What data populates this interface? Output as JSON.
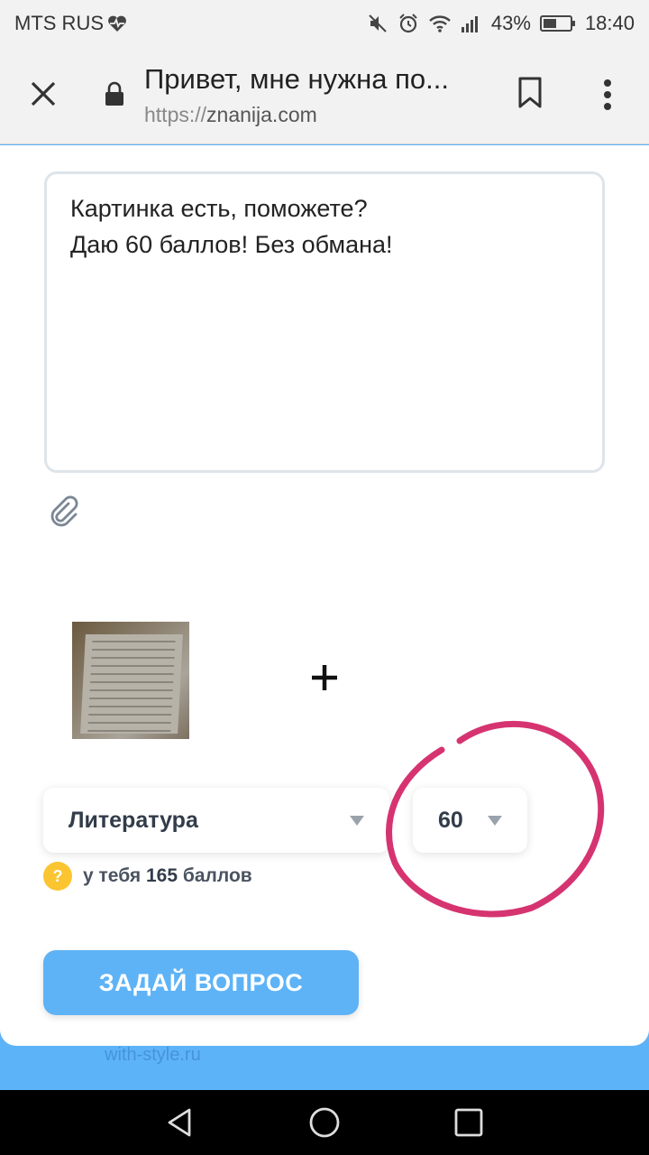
{
  "status_bar": {
    "carrier": "MTS RUS",
    "battery_percent": "43%",
    "time": "18:40",
    "icons": [
      "heart-pulse-icon",
      "mute-icon",
      "alarm-icon",
      "wifi-icon",
      "signal-icon",
      "battery-icon"
    ]
  },
  "browser": {
    "page_title": "Привет, мне нужна по...",
    "url_scheme": "https://",
    "url_host": "znanija.com",
    "icons": [
      "close-icon",
      "lock-icon",
      "bookmark-icon",
      "more-vert-icon"
    ]
  },
  "question": {
    "line1": "Картинка есть, поможете?",
    "line2": "Даю 60 баллов! Без обмана!"
  },
  "subject_select": {
    "value": "Литература"
  },
  "points_select": {
    "value": "60"
  },
  "balance": {
    "prefix": "у тебя",
    "amount": "165",
    "suffix": "баллов",
    "badge": "?"
  },
  "submit_button": {
    "label": "ЗАДАЙ ВОПРОС"
  },
  "watermark": "with-style.ru",
  "annotation": {
    "color": "#d63371"
  },
  "navigation": {
    "icons": [
      "back-icon",
      "home-icon",
      "recent-apps-icon"
    ]
  }
}
